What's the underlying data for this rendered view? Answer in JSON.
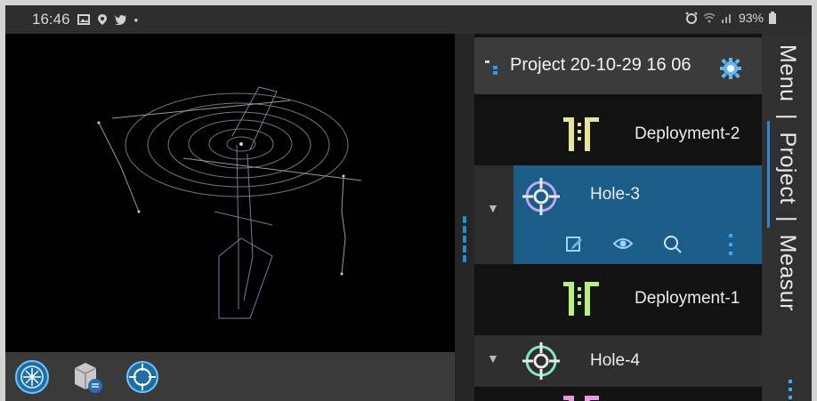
{
  "status_bar": {
    "time": "16:46",
    "battery": "93%",
    "icons": [
      "image-icon",
      "location-icon",
      "twitter-icon",
      "dot-icon",
      "alarm-icon",
      "wifi-icon",
      "signal-icon",
      "battery-icon"
    ]
  },
  "project": {
    "title": "Project 20-10-29 16 06",
    "settings_icon": "gear-icon"
  },
  "items": [
    {
      "label": "Deployment-2",
      "icon": "deployment-icon",
      "accent": "#e8e59a"
    },
    {
      "label": "Hole-3",
      "icon": "crosshair-icon",
      "accent": "#b9a8f0",
      "selected": true
    },
    {
      "label": "Deployment-1",
      "icon": "deployment-icon",
      "accent": "#b9ef7a"
    },
    {
      "label": "Hole-4",
      "icon": "crosshair-icon",
      "accent": "#7fe7c4"
    }
  ],
  "tabs": {
    "menu": "Menu",
    "sep1": "|",
    "project": "Project",
    "sep2": "|",
    "measure": "Measur"
  },
  "colors": {
    "selected_row": "#1c5d88",
    "accent_blue": "#2b8ad2",
    "panel_bg": "#121212"
  }
}
